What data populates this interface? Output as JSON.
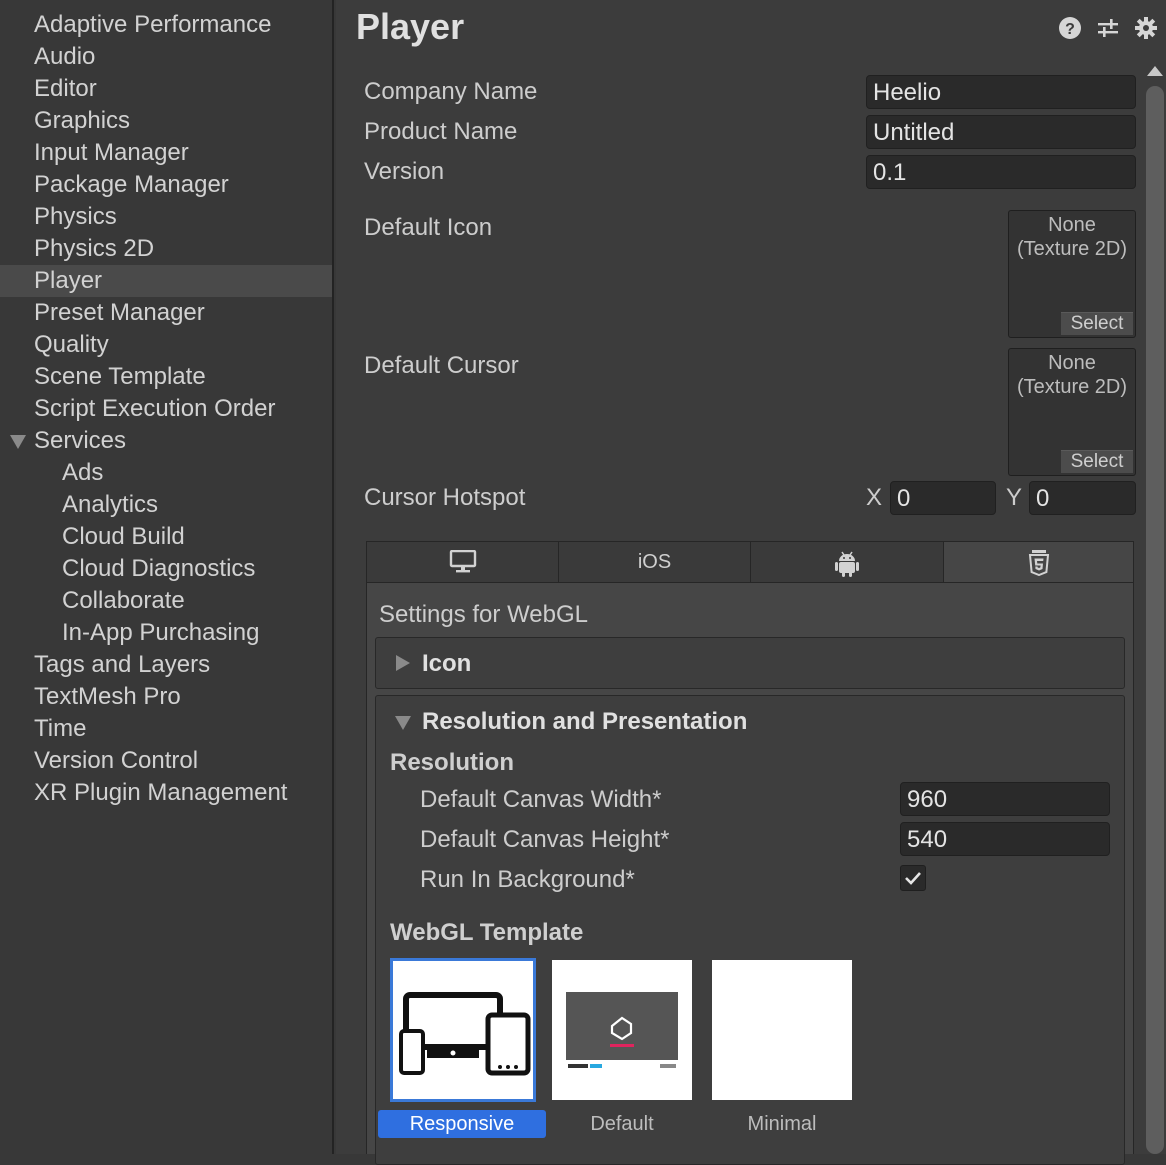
{
  "sidebar": {
    "items": [
      {
        "label": "Adaptive Performance"
      },
      {
        "label": "Audio"
      },
      {
        "label": "Editor"
      },
      {
        "label": "Graphics"
      },
      {
        "label": "Input Manager"
      },
      {
        "label": "Package Manager"
      },
      {
        "label": "Physics"
      },
      {
        "label": "Physics 2D"
      },
      {
        "label": "Player",
        "selected": true
      },
      {
        "label": "Preset Manager"
      },
      {
        "label": "Quality"
      },
      {
        "label": "Scene Template"
      },
      {
        "label": "Script Execution Order"
      },
      {
        "label": "Services",
        "expanded": true
      },
      {
        "label": "Ads",
        "child": true
      },
      {
        "label": "Analytics",
        "child": true
      },
      {
        "label": "Cloud Build",
        "child": true
      },
      {
        "label": "Cloud Diagnostics",
        "child": true
      },
      {
        "label": "Collaborate",
        "child": true
      },
      {
        "label": "In-App Purchasing",
        "child": true
      },
      {
        "label": "Tags and Layers"
      },
      {
        "label": "TextMesh Pro"
      },
      {
        "label": "Time"
      },
      {
        "label": "Version Control"
      },
      {
        "label": "XR Plugin Management"
      }
    ]
  },
  "header": {
    "title": "Player",
    "icons": [
      "help-icon",
      "preset-sliders-icon",
      "gear-icon"
    ]
  },
  "fields": {
    "company_name": {
      "label": "Company Name",
      "value": "Heelio"
    },
    "product_name": {
      "label": "Product Name",
      "value": "Untitled"
    },
    "version": {
      "label": "Version",
      "value": "0.1"
    },
    "default_icon": {
      "label": "Default Icon",
      "none_line1": "None",
      "none_line2": "(Texture 2D)",
      "select": "Select"
    },
    "default_cursor": {
      "label": "Default Cursor",
      "none_line1": "None",
      "none_line2": "(Texture 2D)",
      "select": "Select"
    },
    "cursor_hotspot": {
      "label": "Cursor Hotspot",
      "x_label": "X",
      "x_value": "0",
      "y_label": "Y",
      "y_value": "0"
    }
  },
  "platform_tabs": [
    {
      "icon": "desktop-icon",
      "label": ""
    },
    {
      "icon": "",
      "label": "iOS"
    },
    {
      "icon": "android-icon",
      "label": ""
    },
    {
      "icon": "html5-icon",
      "label": "",
      "active": true
    }
  ],
  "webgl": {
    "settings_title": "Settings for WebGL",
    "icon_foldout": "Icon",
    "resolution_foldout": "Resolution and Presentation",
    "resolution_header": "Resolution",
    "canvas_width": {
      "label": "Default Canvas Width*",
      "value": "960"
    },
    "canvas_height": {
      "label": "Default Canvas Height*",
      "value": "540"
    },
    "run_in_background": {
      "label": "Run In Background*",
      "checked": true
    },
    "template_header": "WebGL Template",
    "templates": [
      {
        "label": "Responsive",
        "selected": true
      },
      {
        "label": "Default",
        "selected": false
      },
      {
        "label": "Minimal",
        "selected": false
      }
    ]
  },
  "colors": {
    "selection_blue": "#2f6fe0",
    "background": "#3c3c3c",
    "sidebar": "#383838"
  }
}
